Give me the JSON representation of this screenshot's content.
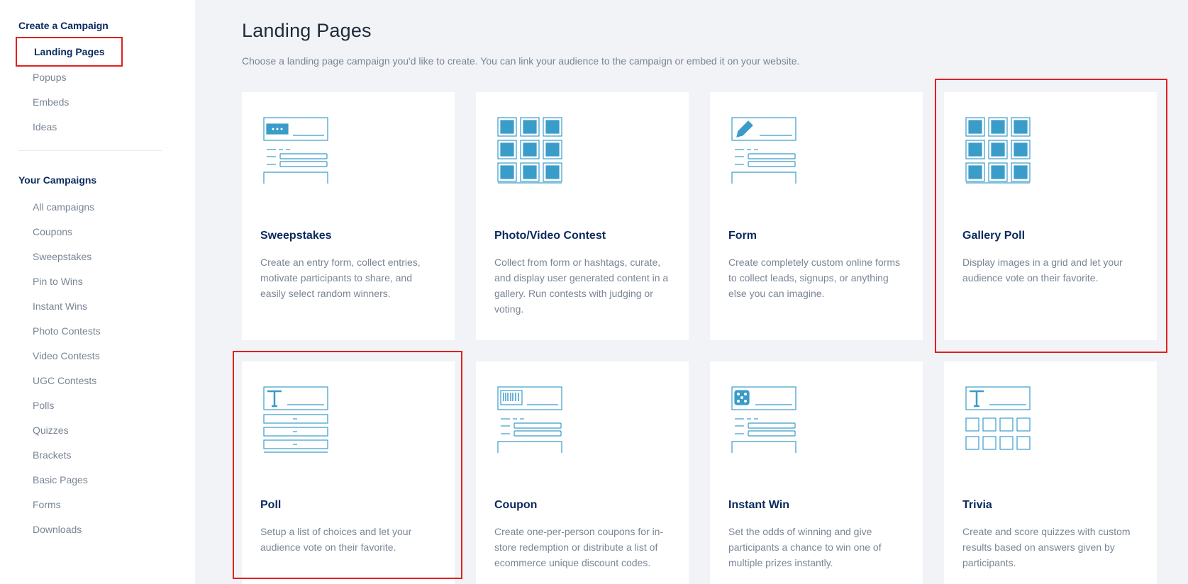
{
  "sidebar": {
    "create_heading": "Create a Campaign",
    "create_items": [
      {
        "label": "Landing Pages"
      },
      {
        "label": "Popups"
      },
      {
        "label": "Embeds"
      },
      {
        "label": "Ideas"
      }
    ],
    "campaigns_heading": "Your Campaigns",
    "campaign_items": [
      {
        "label": "All campaigns"
      },
      {
        "label": "Coupons"
      },
      {
        "label": "Sweepstakes"
      },
      {
        "label": "Pin to Wins"
      },
      {
        "label": "Instant Wins"
      },
      {
        "label": "Photo Contests"
      },
      {
        "label": "Video Contests"
      },
      {
        "label": "UGC Contests"
      },
      {
        "label": "Polls"
      },
      {
        "label": "Quizzes"
      },
      {
        "label": "Brackets"
      },
      {
        "label": "Basic Pages"
      },
      {
        "label": "Forms"
      },
      {
        "label": "Downloads"
      }
    ]
  },
  "main": {
    "title": "Landing Pages",
    "subtitle": "Choose a landing page campaign you'd like to create. You can link your audience to the campaign or embed it on your website.",
    "cards": [
      {
        "title": "Sweepstakes",
        "desc": "Create an entry form, collect entries, motivate participants to share, and easily select random winners.",
        "icon": "ticket-form-icon"
      },
      {
        "title": "Photo/Video Contest",
        "desc": "Collect from form or hashtags, curate, and display user generated content in a gallery. Run contests with judging or voting.",
        "icon": "image-grid-icon"
      },
      {
        "title": "Form",
        "desc": "Create completely custom online forms to collect leads, signups, or anything else you can imagine.",
        "icon": "pencil-form-icon"
      },
      {
        "title": "Gallery Poll",
        "desc": "Display images in a grid and let your audience vote on their favorite.",
        "icon": "image-grid-icon"
      },
      {
        "title": "Poll",
        "desc": "Setup a list of choices and let your audience vote on their favorite.",
        "icon": "text-list-icon"
      },
      {
        "title": "Coupon",
        "desc": "Create one-per-person coupons for in-store redemption or distribute a list of ecommerce unique discount codes.",
        "icon": "barcode-form-icon"
      },
      {
        "title": "Instant Win",
        "desc": "Set the odds of winning and give participants a chance to win one of multiple prizes instantly.",
        "icon": "dice-form-icon"
      },
      {
        "title": "Trivia",
        "desc": "Create and score quizzes with custom results based on answers given by participants.",
        "icon": "text-grid-icon"
      }
    ]
  },
  "colors": {
    "accent": "#3a9cc8",
    "heading": "#0a2a5e",
    "highlight": "#e02020"
  }
}
